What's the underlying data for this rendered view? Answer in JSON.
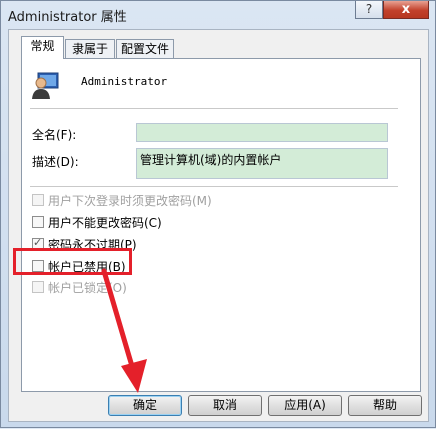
{
  "window": {
    "title": "Administrator 属性",
    "help_label": "?",
    "close_label": "x"
  },
  "tabs": [
    {
      "label": "常规"
    },
    {
      "label": "隶属于"
    },
    {
      "label": "配置文件"
    }
  ],
  "general": {
    "username": "Administrator",
    "fullname_label": "全名(F):",
    "fullname_value": "",
    "description_label": "描述(D):",
    "description_value": "管理计算机(域)的内置帐户"
  },
  "checkboxes": [
    {
      "label": "用户下次登录时须更改密码(M)",
      "checked": false,
      "disabled": true
    },
    {
      "label": "用户不能更改密码(C)",
      "checked": false,
      "disabled": false
    },
    {
      "label": "密码永不过期(P)",
      "checked": true,
      "disabled": false
    },
    {
      "label": "帐户已禁用(B)",
      "checked": false,
      "disabled": false
    },
    {
      "label": "帐户已锁定(O)",
      "checked": false,
      "disabled": true
    }
  ],
  "buttons": {
    "ok": "确定",
    "cancel": "取消",
    "apply": "应用(A)",
    "help": "帮助"
  },
  "colors": {
    "highlight_box": "#e4202a",
    "arrow": "#e4202a",
    "field_bg": "#d3ecd7"
  }
}
